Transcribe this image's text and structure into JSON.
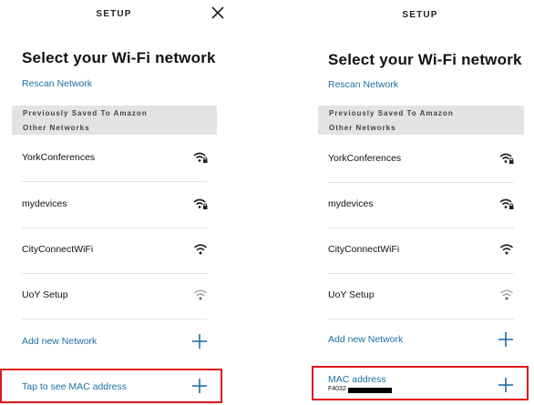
{
  "left": {
    "header_title": "SETUP",
    "heading": "Select your Wi-Fi network",
    "rescan_label": "Rescan Network",
    "saved_section": "Previously Saved To Amazon",
    "other_section": "Other Networks",
    "networks": [
      {
        "name": "YorkConferences",
        "icon": "wifi-lock-icon"
      },
      {
        "name": "mydevices",
        "icon": "wifi-lock-icon"
      },
      {
        "name": "CityConnectWiFi",
        "icon": "wifi-icon"
      },
      {
        "name": "UoY Setup",
        "icon": "wifi-weak-icon"
      }
    ],
    "add_network_label": "Add new Network",
    "mac_label": "Tap to see MAC address"
  },
  "right": {
    "header_title": "SETUP",
    "heading": "Select your Wi-Fi network",
    "rescan_label": "Rescan Network",
    "saved_section": "Previously Saved To Amazon",
    "other_section": "Other Networks",
    "networks": [
      {
        "name": "YorkConferences",
        "icon": "wifi-lock-icon"
      },
      {
        "name": "mydevices",
        "icon": "wifi-lock-icon"
      },
      {
        "name": "CityConnectWiFi",
        "icon": "wifi-icon"
      },
      {
        "name": "UoY Setup",
        "icon": "wifi-weak-icon"
      }
    ],
    "add_network_label": "Add new Network",
    "mac_label": "MAC address",
    "mac_value_prefix": "F4032"
  },
  "colors": {
    "link": "#1d6fa3",
    "highlight": "#e0161b",
    "section_bg": "#e3e3e3"
  }
}
